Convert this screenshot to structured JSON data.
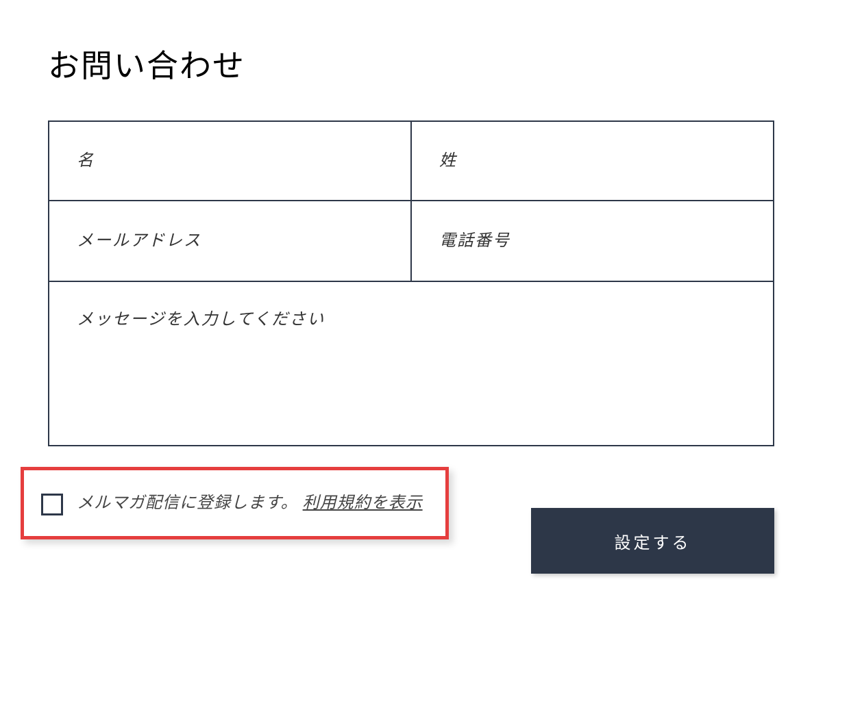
{
  "title": "お問い合わせ",
  "form": {
    "firstName": {
      "placeholder": "名",
      "value": ""
    },
    "lastName": {
      "placeholder": "姓",
      "value": ""
    },
    "email": {
      "placeholder": "メールアドレス",
      "value": ""
    },
    "phone": {
      "placeholder": "電話番号",
      "value": ""
    },
    "message": {
      "placeholder": "メッセージを入力してください",
      "value": ""
    }
  },
  "newsletter": {
    "checked": false,
    "labelPrefix": "メルマガ配信に登録します。",
    "termsLink": "利用規約を表示"
  },
  "submitLabel": "設定する"
}
